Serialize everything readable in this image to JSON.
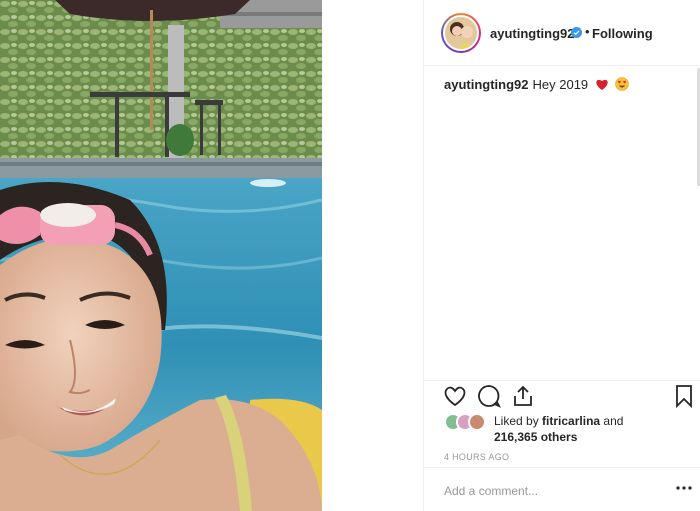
{
  "post": {
    "username": "ayutingting92",
    "follow_status": "Following",
    "separator": "•",
    "caption_username": "ayutingting92",
    "caption_text": "Hey 2019",
    "caption_emojis": [
      "red-heart",
      "heart-eyes-face"
    ],
    "liked_by_prefix": "Liked by",
    "liked_by_user": "fitricarlina",
    "liked_by_and": "and",
    "liked_by_others": "216,365 others",
    "timestamp": "4 HOURS AGO",
    "comment_placeholder": "Add a comment..."
  },
  "colors": {
    "verified": "#3897f0",
    "heart": "#ed4956",
    "text": "#262626",
    "muted": "#999999"
  }
}
